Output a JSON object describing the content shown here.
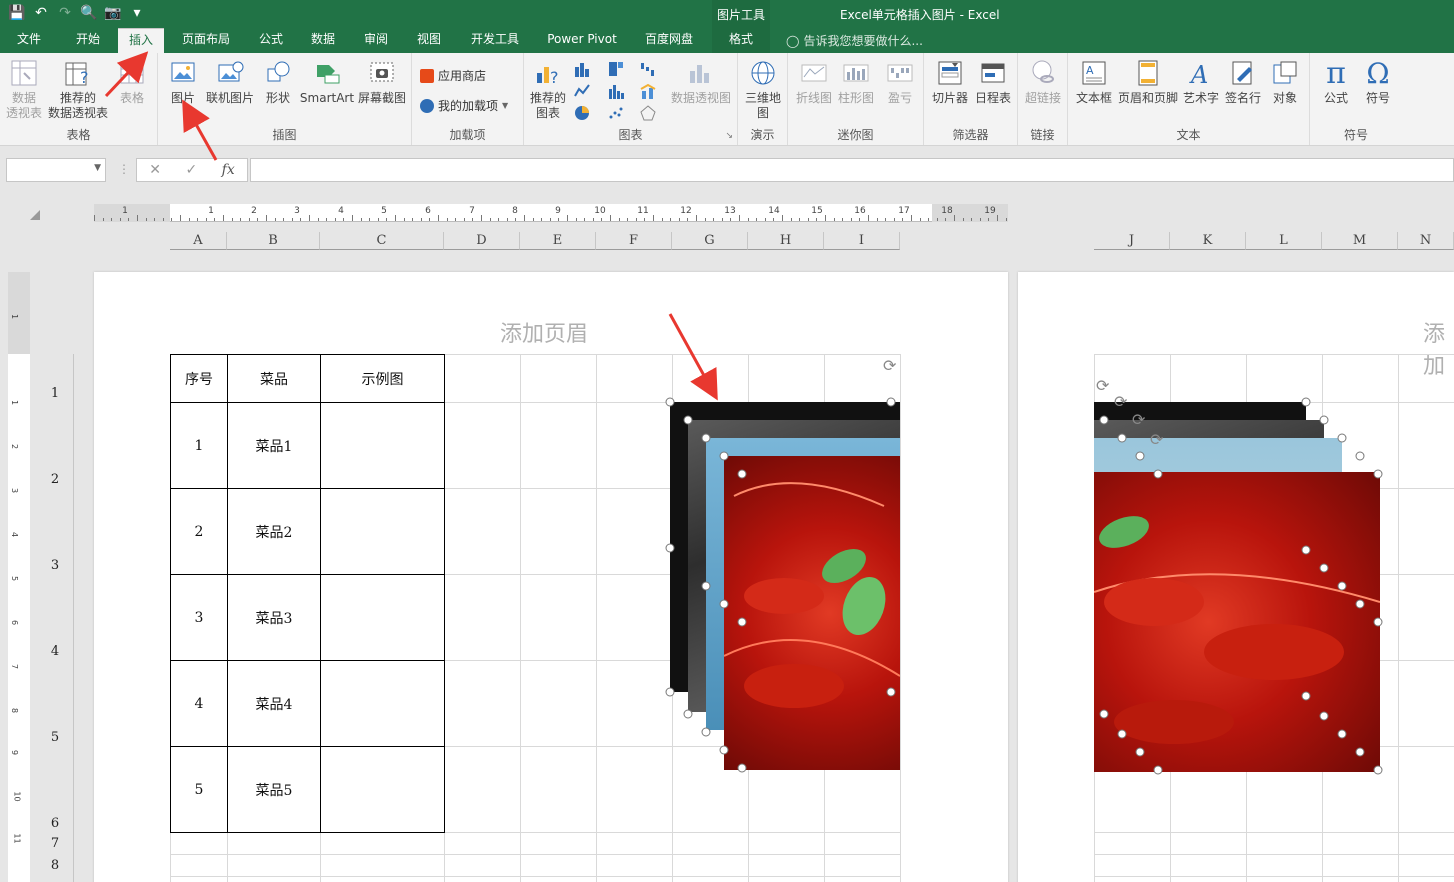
{
  "window": {
    "title": "Excel单元格插入图片 - Excel",
    "context_group": "图片工具"
  },
  "tabs": [
    {
      "label": "文件"
    },
    {
      "label": "开始"
    },
    {
      "label": "插入"
    },
    {
      "label": "页面布局"
    },
    {
      "label": "公式"
    },
    {
      "label": "数据"
    },
    {
      "label": "审阅"
    },
    {
      "label": "视图"
    },
    {
      "label": "开发工具"
    },
    {
      "label": "Power Pivot"
    },
    {
      "label": "百度网盘"
    },
    {
      "label": "格式"
    }
  ],
  "active_tab": "插入",
  "tell_me": "告诉我您想要做什么...",
  "ribbon": {
    "tables": {
      "label": "表格",
      "pivot": "数据\n透视表",
      "recommended_pivot": "推荐的\n数据透视表",
      "table": "表格"
    },
    "illustrations": {
      "label": "插图",
      "picture": "图片",
      "online_picture": "联机图片",
      "shapes": "形状",
      "smartart": "SmartArt",
      "screenshot": "屏幕截图"
    },
    "addins": {
      "label": "加载项",
      "store": "应用商店",
      "my_addins": "我的加载项"
    },
    "charts": {
      "label": "图表",
      "recommended": "推荐的\n图表",
      "pivot_chart": "数据透视图"
    },
    "tours": {
      "label": "演示",
      "map3d": "三维地\n图"
    },
    "sparklines": {
      "label": "迷你图",
      "line": "折线图",
      "column": "柱形图",
      "winloss": "盈亏"
    },
    "filters": {
      "label": "筛选器",
      "slicer": "切片器",
      "timeline": "日程表"
    },
    "links": {
      "label": "链接",
      "hyperlink": "超链接"
    },
    "text": {
      "label": "文本",
      "textbox": "文本框",
      "header_footer": "页眉和页脚",
      "wordart": "艺术字",
      "signature": "签名行",
      "object": "对象"
    },
    "symbols": {
      "label": "符号",
      "equation": "公式",
      "symbol": "符号"
    }
  },
  "formula_bar": {
    "name_box": "",
    "fx": "fx",
    "content": ""
  },
  "columns_page1": [
    "A",
    "B",
    "C",
    "D",
    "E",
    "F",
    "G",
    "H",
    "I"
  ],
  "columns_page2": [
    "J",
    "K",
    "L",
    "M",
    "N"
  ],
  "rows": [
    "1",
    "2",
    "3",
    "4",
    "5",
    "6",
    "7",
    "8"
  ],
  "ruler_numbers": [
    "1",
    "1",
    "2",
    "3",
    "4",
    "5",
    "6",
    "7",
    "8",
    "9",
    "10",
    "11",
    "12",
    "13",
    "14",
    "15",
    "16",
    "17",
    "18",
    "19"
  ],
  "vruler_numbers": [
    "1",
    "1",
    "2",
    "3",
    "4",
    "5",
    "6",
    "7",
    "8",
    "9",
    "10",
    "11"
  ],
  "header_placeholder": "添加页眉",
  "header_placeholder_page2": "添加",
  "table": {
    "headers": [
      "序号",
      "菜品",
      "示例图"
    ],
    "rows": [
      [
        "1",
        "菜品1",
        ""
      ],
      [
        "2",
        "菜品2",
        ""
      ],
      [
        "3",
        "菜品3",
        ""
      ],
      [
        "4",
        "菜品4",
        ""
      ],
      [
        "5",
        "菜品5",
        ""
      ]
    ]
  },
  "colors": {
    "excel_green": "#217346",
    "annotation_red": "#e8382f"
  }
}
